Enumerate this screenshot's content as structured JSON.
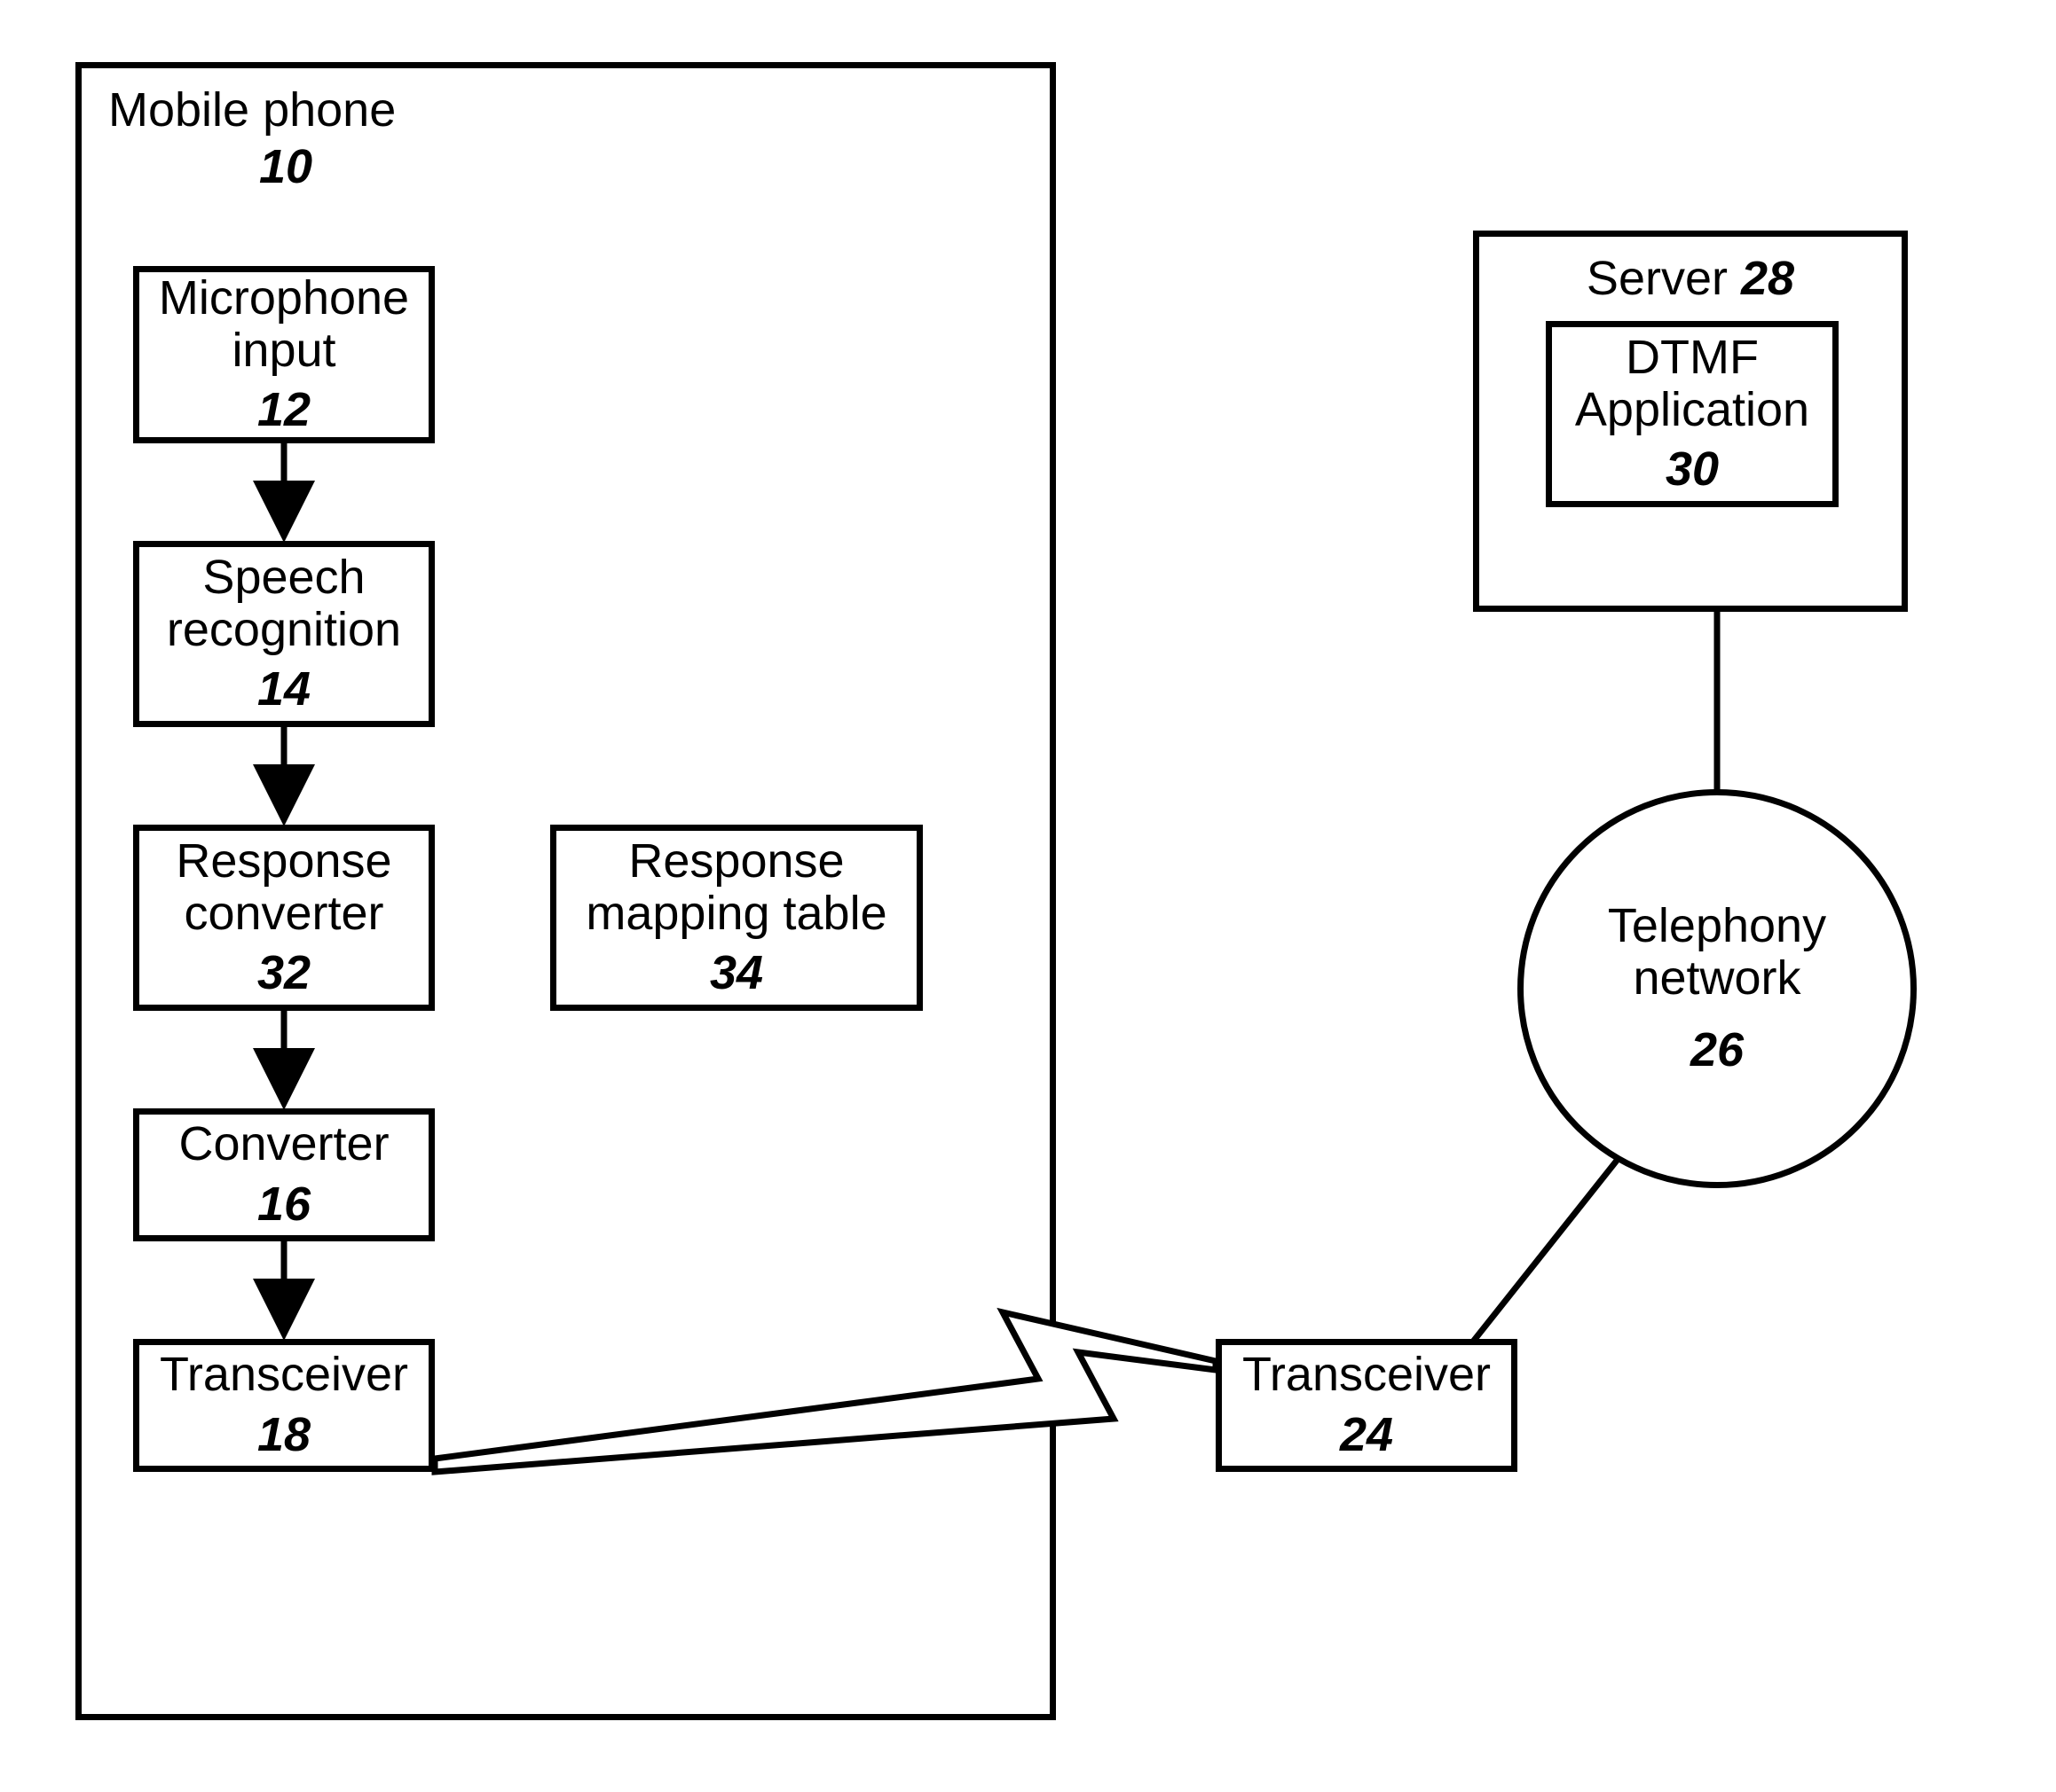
{
  "mobilePhone": {
    "title": "Mobile phone",
    "num": "10",
    "microphone": {
      "line1": "Microphone",
      "line2": "input",
      "num": "12"
    },
    "speech": {
      "line1": "Speech",
      "line2": "recognition",
      "num": "14"
    },
    "respConv": {
      "line1": "Response",
      "line2": "converter",
      "num": "32"
    },
    "respMap": {
      "line1": "Response",
      "line2": "mapping table",
      "num": "34"
    },
    "converter": {
      "line1": "Converter",
      "num": "16"
    },
    "transceiver": {
      "line1": "Transceiver",
      "num": "18"
    }
  },
  "transceiver2": {
    "line1": "Transceiver",
    "num": "24"
  },
  "server": {
    "title": "Server ",
    "num": "28",
    "dtmf": {
      "line1": "DTMF",
      "line2": "Application",
      "num": "30"
    }
  },
  "telephony": {
    "line1": "Telephony",
    "line2": "network",
    "num": "26"
  }
}
